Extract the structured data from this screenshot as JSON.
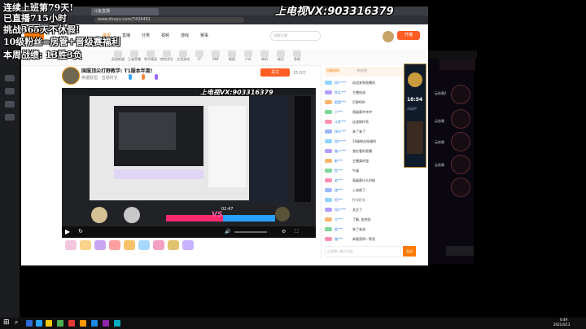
{
  "overlay": {
    "line1": "连续上班第79天!",
    "line2": "已直播715小时",
    "line3": "挑战365天不休假!",
    "line4": "10级粉丝=房管+晋级赛福利",
    "line5": "本周战绩: 13胜3负",
    "vx_top": "上电视VX:903316379",
    "vx_player": "上电视VX:903316379"
  },
  "browser": {
    "tab1": "斗鱼直播",
    "url": "www.douyu.com/7428481",
    "nav_items": [
      "首页",
      "直播",
      "分类",
      "视频",
      "游戏",
      "赛事"
    ],
    "search_placeholder": "搜索主播",
    "open_broadcast": "开播"
  },
  "categories": [
    "英雄联盟",
    "王者荣耀",
    "和平精英",
    "绝地求生",
    "主机游戏",
    "CF",
    "DNF",
    "颜值",
    "户外",
    "单机",
    "娱乐",
    "鱼吧"
  ],
  "stream": {
    "title": "国服顶尖打野教学: T1服本年度!",
    "meta": "英雄联盟 · 直播时长",
    "follow": "关注",
    "follow_count": "25.6万"
  },
  "player": {
    "time": "02:47",
    "versus": "VS",
    "live_label": "直播"
  },
  "chat": {
    "tabs": [
      "贡献周榜",
      "粉丝榜"
    ],
    "messages": [
      {
        "name": "用户***",
        "text": "欢迎来到直播间"
      },
      {
        "name": "鱼丸***",
        "text": "主播加油"
      },
      {
        "name": "超管***",
        "text": "打野666"
      },
      {
        "name": "小***",
        "text": "晋级赛冲冲冲"
      },
      {
        "name": "斗鱼***",
        "text": "这波操作秀"
      },
      {
        "name": "快乐***",
        "text": "来了来了"
      },
      {
        "name": "用户***",
        "text": "10级粉丝啥福利"
      },
      {
        "name": "路人***",
        "text": "我在看你直播"
      },
      {
        "name": "新***",
        "text": "主播真的强"
      },
      {
        "name": "鱼***",
        "text": "牛逼"
      },
      {
        "name": "老***",
        "text": "晋级赛什么时候"
      },
      {
        "name": "甜***",
        "text": "上电视了"
      },
      {
        "name": "阿***",
        "text": "打卡打卡"
      },
      {
        "name": "用户***",
        "text": "关注了"
      },
      {
        "name": "大***",
        "text": "了解, 加把劲"
      },
      {
        "name": "星***",
        "text": "来了老弟"
      },
      {
        "name": "路***",
        "text": "恭喜获得一等奖"
      }
    ],
    "input_placeholder": "这里输入聊天内容",
    "send": "发送"
  },
  "game": {
    "rank_time": "18:54",
    "rank_label": "对局中",
    "player1": "云依赖2",
    "player2": "云依赖",
    "player3": "云依赖",
    "player4": "云依赖"
  },
  "taskbar": {
    "time": "0:49",
    "date": "2021/4/12"
  },
  "colors": {
    "accent": "#f08c00",
    "douyu_orange": "#ff7a00",
    "vs_pink": "#ff2a6d",
    "vs_blue": "#2aa0ff"
  }
}
